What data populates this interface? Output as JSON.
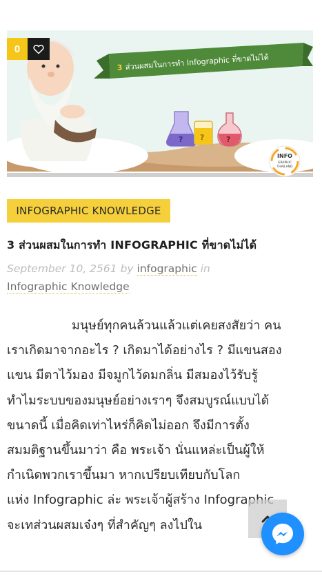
{
  "post": {
    "likes_count": "0",
    "hero_image": {
      "banner_number": "3",
      "banner_text": "ส่วนผสมในการทำ Infographic ที่ขาดไม่ได้",
      "badge_line1": "INFO",
      "badge_line2": "GRAPHIC",
      "badge_line3": "THAILAND"
    },
    "category": "INFOGRAPHIC KNOWLEDGE",
    "title": "3 ส่วนผสมในการทำ INFOGRAPHIC ที่ขาดไม่ได้",
    "meta": {
      "date": "September 10, 2561",
      "by_label": "by",
      "author": "infographic",
      "in_label": "in",
      "category_link": "Infographic Knowledge"
    },
    "content_lines": [
      "มนุษย์ทุกคนล้วนแล้วแต่เคยสงสัยว่า คน",
      "เราเกิดมาจากอะไร ? เกิดมาได้อย่างไร ? มีแขนสอง",
      "แขน มีตาไว้มอง มีจมูกไว้ดมกลิ่น มีสมองไว้รับรู้",
      " ทำไมระบบของมนุษย์อย่างเราๆ จึงสมบูรณ์แบบได้",
      "ขนาดนี้ เมื่อคิดเท่าไหร่ก็คิดไม่ออก  จึงมีการตั้ง",
      "สมมติฐานขึ้นมาว่า คือ พระเจ้า นั่นแหล่ะเป็นผู้ให้",
      "กำเนิดพวกเราขึ้นมา  หากเปรียบเทียบกับโลก",
      "แห่ง Infographic ล่ะ  พระเจ้าผู้สร้าง Infographic",
      "จะเทส่วนผสมเจ๋งๆ ที่สำคัญๆ ลงไปใน"
    ]
  },
  "icons": {
    "like": "heart-outline-icon",
    "scroll_top": "chevron-up-icon",
    "chat": "messenger-icon"
  },
  "colors": {
    "accent_yellow": "#f5d03a",
    "like_count_bg": "#f5c518",
    "like_button_bg": "#1b1b1b",
    "messenger_blue": "#1e90ff"
  }
}
